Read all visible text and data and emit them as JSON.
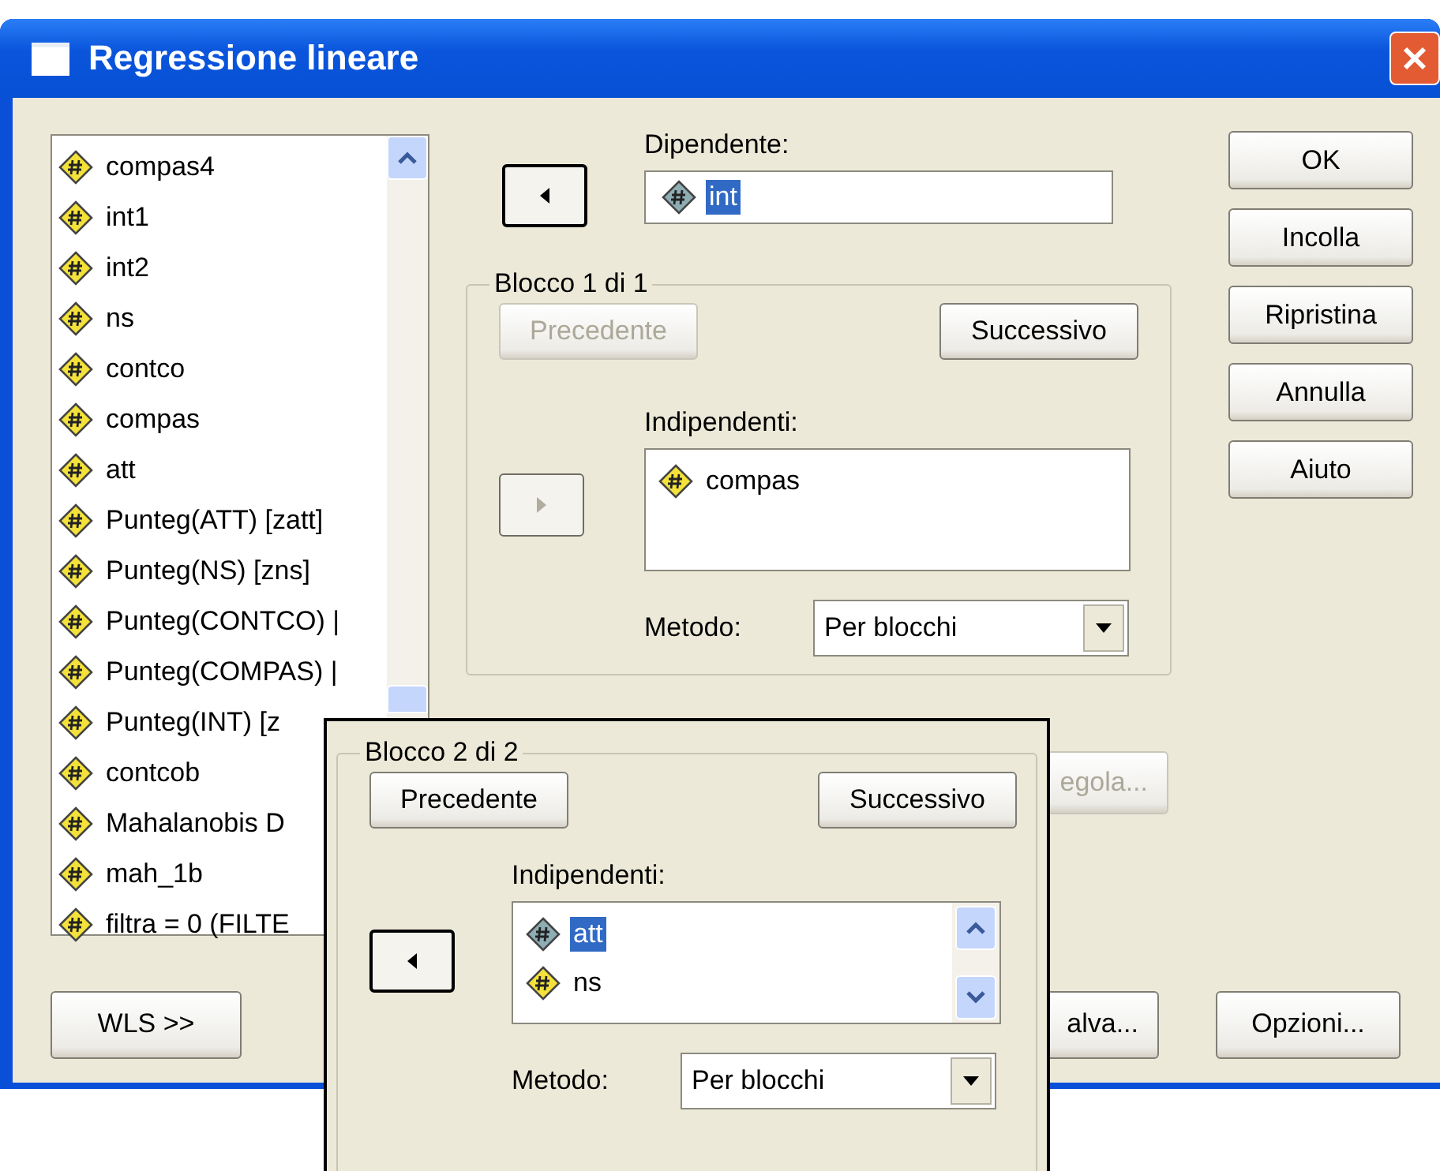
{
  "window": {
    "title": "Regressione lineare"
  },
  "variables": [
    {
      "label": "compas4",
      "selected": false
    },
    {
      "label": "int1",
      "selected": false
    },
    {
      "label": "int2",
      "selected": false
    },
    {
      "label": "ns",
      "selected": false
    },
    {
      "label": "contco",
      "selected": false
    },
    {
      "label": "compas",
      "selected": false
    },
    {
      "label": "att",
      "selected": false
    },
    {
      "label": "Punteg(ATT) [zatt]",
      "selected": false
    },
    {
      "label": "Punteg(NS) [zns]",
      "selected": false
    },
    {
      "label": "Punteg(CONTCO) |",
      "selected": false
    },
    {
      "label": "Punteg(COMPAS) |",
      "selected": false
    },
    {
      "label": "Punteg(INT) [z",
      "selected": false
    },
    {
      "label": "contcob",
      "selected": false
    },
    {
      "label": "Mahalanobis D",
      "selected": false
    },
    {
      "label": "mah_1b",
      "selected": false
    },
    {
      "label": "filtra = 0 (FILTE",
      "selected": false
    }
  ],
  "dependent": {
    "label": "Dipendente:",
    "move_button": {
      "kind": "left",
      "focused": true,
      "disabled": false
    },
    "value": {
      "label": "int",
      "selected": true
    }
  },
  "block": {
    "title": "Blocco 1 di 1",
    "previous": {
      "label": "Precedente",
      "disabled": true
    },
    "next": {
      "label": "Successivo",
      "disabled": false
    },
    "move_button": {
      "kind": "right",
      "focused": false,
      "disabled": true
    },
    "independents_label": "Indipendenti:",
    "independents": [
      {
        "label": "compas",
        "selected": false
      }
    ],
    "method_label": "Metodo:",
    "method": "Per blocchi"
  },
  "regola_button": {
    "label": "egola...",
    "disabled": true
  },
  "side_buttons": [
    {
      "label": "OK"
    },
    {
      "label": "Incolla"
    },
    {
      "label": "Ripristina"
    },
    {
      "label": "Annulla"
    },
    {
      "label": "Aiuto"
    }
  ],
  "bottom_buttons": [
    {
      "label": "WLS >>"
    },
    {
      "label": "alva..."
    },
    {
      "label": "Opzioni..."
    }
  ],
  "overlay_block": {
    "title": "Blocco 2 di 2",
    "previous": {
      "label": "Precedente",
      "disabled": false
    },
    "next": {
      "label": "Successivo",
      "disabled": false
    },
    "move_button": {
      "kind": "left",
      "focused": true,
      "disabled": false
    },
    "independents_label": "Indipendenti:",
    "independents": [
      {
        "label": "att",
        "selected": true
      },
      {
        "label": "ns",
        "selected": false
      }
    ],
    "method_label": "Metodo:",
    "method": "Per blocchi"
  }
}
